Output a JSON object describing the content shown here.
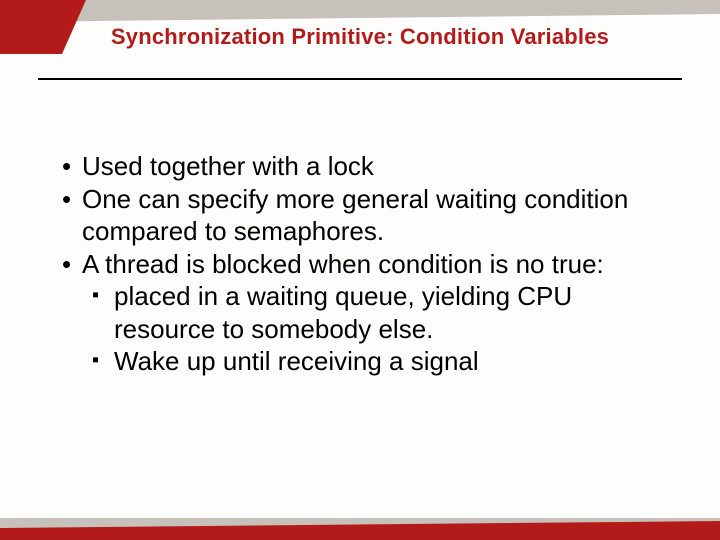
{
  "title": "Synchronization Primitive: Condition Variables",
  "bullets": {
    "b0": "Used together with a lock",
    "b1": "One can specify more general waiting condition compared to semaphores.",
    "b2": "A thread  is blocked when condition is no true:",
    "s0": "placed in a waiting queue,  yielding CPU resource to somebody else.",
    "s1": "Wake up until receiving a signal"
  },
  "colors": {
    "brand_red": "#b31b1b",
    "gray": "#c7c1bb"
  }
}
